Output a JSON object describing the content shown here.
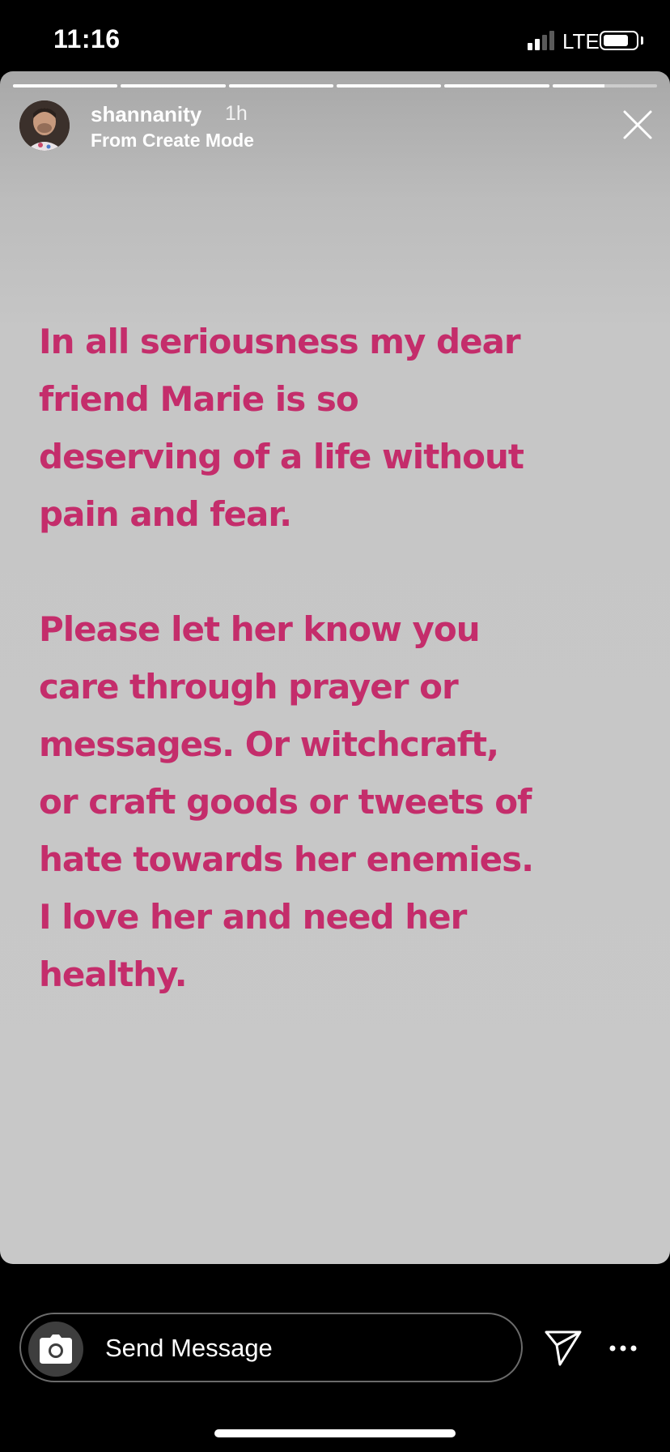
{
  "status_bar": {
    "time": "11:16",
    "network": "LTE",
    "signal_bars_active": 2,
    "signal_bars_total": 4,
    "battery_level": 0.8
  },
  "story": {
    "segments_total": 6,
    "segments_completed": 5,
    "current_segment_progress": 0.5,
    "user": {
      "username": "shannanity",
      "time_ago": "1h",
      "subtitle": "From Create Mode"
    },
    "paragraphs": [
      "In all seriousness my dear\nfriend Marie is so\ndeserving of a life without\npain and fear.",
      "Please let her know you\ncare through prayer or\nmessages. Or witchcraft,\nor craft goods or tweets of\nhate towards her enemies.\nI love her and need her\nhealthy."
    ],
    "text_color": "#c42d6b",
    "background_color": "#c8c8c8"
  },
  "bottom_bar": {
    "send_placeholder": "Send Message",
    "icons": {
      "camera": "camera-icon",
      "direct": "paper-plane-icon",
      "more": "more-icon",
      "close": "close-icon"
    }
  }
}
